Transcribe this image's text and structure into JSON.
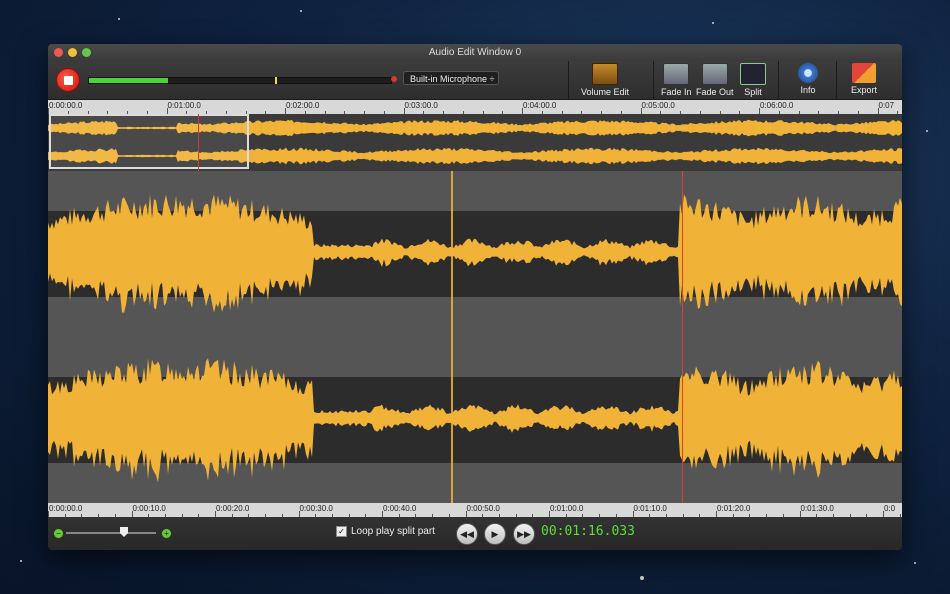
{
  "window": {
    "title": "Audio Edit Window 0"
  },
  "input": {
    "source": "Built-in Microphone ÷",
    "meter_level": 0.26
  },
  "tools": [
    {
      "label": "Volume Edit",
      "icon": "volume-edit-icon"
    },
    {
      "label": "Fade In",
      "icon": "fade-in-icon"
    },
    {
      "label": "Fade Out",
      "icon": "fade-out-icon"
    },
    {
      "label": "Split",
      "icon": "split-icon"
    },
    {
      "label": "Info",
      "icon": "gear-icon"
    },
    {
      "label": "Export",
      "icon": "export-icon"
    }
  ],
  "timeline_top": [
    "0:00:00.0",
    "0:01:00.0",
    "0:02:00.0",
    "0:03:00.0",
    "0:04:00.0",
    "0:05:00.0",
    "0:06:00.0",
    "0:07"
  ],
  "timeline_bottom": [
    "0:00:00.0",
    "0:00:10.0",
    "0:00:20.0",
    "0:00:30.0",
    "0:00:40.0",
    "0:00:50.0",
    "0:01:00.0",
    "0:01:10.0",
    "0:01:20.0",
    "0:01:30.0",
    "0:0"
  ],
  "footer": {
    "loop_label": "Loop play split part",
    "time": "00:01:16.033"
  },
  "colors": {
    "wave": "#f0b237",
    "accent": "#5fdc3a",
    "playhead": "#d42"
  }
}
